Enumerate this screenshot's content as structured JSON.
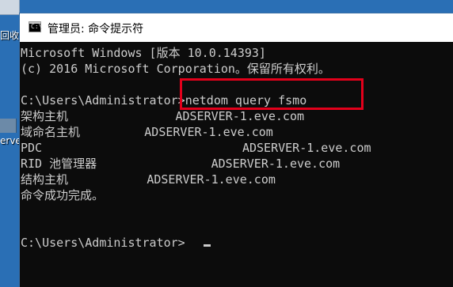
{
  "desktop": {
    "recycle_label": "回收站",
    "server_label": "erver"
  },
  "window": {
    "title": "管理员: 命令提示符"
  },
  "console": {
    "lines": [
      "Microsoft Windows [版本 10.0.14393]",
      "(c) 2016 Microsoft Corporation。保留所有权利。",
      "",
      "C:\\Users\\Administrator>netdom query fsmo",
      "架构主机               ADSERVER-1.eve.com",
      "域命名主机         ADSERVER-1.eve.com",
      "PDC                            ADSERVER-1.eve.com",
      "RID 池管理器                ADSERVER-1.eve.com",
      "结构主机           ADSERVER-1.eve.com",
      "命令成功完成。",
      "",
      "",
      "C:\\Users\\Administrator>"
    ]
  },
  "colors": {
    "console_bg": "#0c0c0c",
    "console_fg": "#cccccc",
    "highlight": "#e3001b"
  }
}
